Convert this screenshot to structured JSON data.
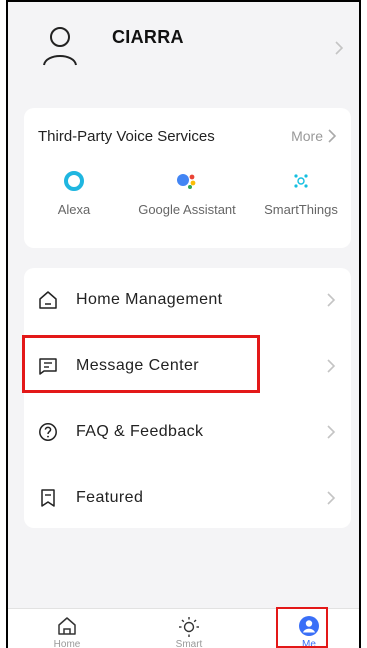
{
  "profile": {
    "username": "CIARRA"
  },
  "voice_services": {
    "title": "Third-Party Voice Services",
    "more_label": "More",
    "items": [
      {
        "label": "Alexa",
        "icon": "alexa-icon"
      },
      {
        "label": "Google Assistant",
        "icon": "google-assistant-icon"
      },
      {
        "label": "SmartThings",
        "icon": "smartthings-icon"
      }
    ]
  },
  "menu": {
    "items": [
      {
        "label": "Home Management",
        "icon": "house-icon"
      },
      {
        "label": "Message Center",
        "icon": "message-icon"
      },
      {
        "label": "FAQ & Feedback",
        "icon": "question-icon"
      },
      {
        "label": "Featured",
        "icon": "bookmark-icon"
      }
    ]
  },
  "tabbar": {
    "tabs": [
      {
        "label": "Home",
        "icon": "home-outline-icon"
      },
      {
        "label": "Smart",
        "icon": "sun-icon"
      },
      {
        "label": "Me",
        "icon": "user-icon"
      }
    ]
  },
  "colors": {
    "accent": "#3a6ff7",
    "highlight": "#e31818",
    "background": "#f4f4f6"
  }
}
